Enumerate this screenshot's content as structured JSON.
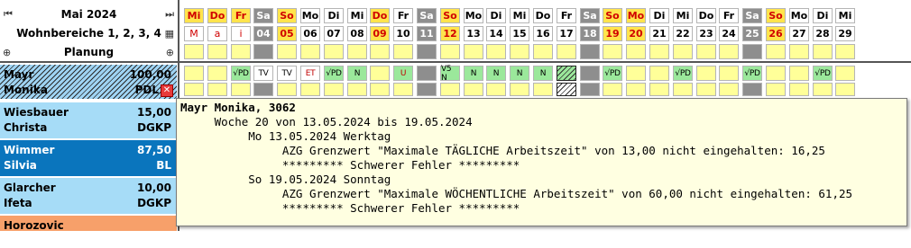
{
  "header": {
    "month": "Mai 2024",
    "unit": "Wohnbereiche 1, 2, 3, 4",
    "view": "Planung"
  },
  "days": [
    {
      "d": "Mi",
      "n": "M",
      "t": "hol"
    },
    {
      "d": "Do",
      "n": "a",
      "t": "hol"
    },
    {
      "d": "Fr",
      "n": "i",
      "t": "hol"
    },
    {
      "d": "Sa",
      "n": "04",
      "t": "we"
    },
    {
      "d": "So",
      "n": "05",
      "t": "so"
    },
    {
      "d": "Mo",
      "n": "06",
      "t": ""
    },
    {
      "d": "Di",
      "n": "07",
      "t": ""
    },
    {
      "d": "Mi",
      "n": "08",
      "t": ""
    },
    {
      "d": "Do",
      "n": "09",
      "t": "so"
    },
    {
      "d": "Fr",
      "n": "10",
      "t": ""
    },
    {
      "d": "Sa",
      "n": "11",
      "t": "we"
    },
    {
      "d": "So",
      "n": "12",
      "t": "so"
    },
    {
      "d": "Mo",
      "n": "13",
      "t": ""
    },
    {
      "d": "Di",
      "n": "14",
      "t": ""
    },
    {
      "d": "Mi",
      "n": "15",
      "t": ""
    },
    {
      "d": "Do",
      "n": "16",
      "t": ""
    },
    {
      "d": "Fr",
      "n": "17",
      "t": ""
    },
    {
      "d": "Sa",
      "n": "18",
      "t": "we"
    },
    {
      "d": "So",
      "n": "19",
      "t": "so"
    },
    {
      "d": "Mo",
      "n": "20",
      "t": "so"
    },
    {
      "d": "Di",
      "n": "21",
      "t": ""
    },
    {
      "d": "Mi",
      "n": "22",
      "t": ""
    },
    {
      "d": "Do",
      "n": "23",
      "t": ""
    },
    {
      "d": "Fr",
      "n": "24",
      "t": ""
    },
    {
      "d": "Sa",
      "n": "25",
      "t": "we"
    },
    {
      "d": "So",
      "n": "26",
      "t": "so"
    },
    {
      "d": "Mo",
      "n": "27",
      "t": ""
    },
    {
      "d": "Di",
      "n": "28",
      "t": ""
    },
    {
      "d": "Mi",
      "n": "29",
      "t": ""
    }
  ],
  "shifts": [
    "",
    "",
    "√PD",
    "TV",
    "TV",
    "ET",
    "√PD",
    "N",
    "",
    "U",
    "",
    "V5 N",
    "N",
    "N",
    "N",
    "N",
    "",
    "",
    "√PD",
    "",
    "",
    "√PD",
    "",
    "",
    "√PD",
    "",
    "",
    "√PD",
    ""
  ],
  "employees": [
    {
      "last": "Mayr",
      "first": "Monika",
      "hours": "100,00",
      "role": "PDL",
      "style": "selected"
    },
    {
      "last": "Wiesbauer",
      "first": "Christa",
      "hours": "15,00",
      "role": "DGKP",
      "style": "light"
    },
    {
      "last": "Wimmer",
      "first": "Silvia",
      "hours": "87,50",
      "role": "BL",
      "style": "dark"
    },
    {
      "last": "Glarcher",
      "first": "Ifeta",
      "hours": "10,00",
      "role": "DGKP",
      "style": "light"
    },
    {
      "last": "Horozovic",
      "first": "",
      "hours": "",
      "role": "",
      "style": "orange"
    }
  ],
  "tooltip": {
    "lines": [
      "Mayr Monika, 3062",
      "     Woche 20 von 13.05.2024 bis 19.05.2024",
      "          Mo 13.05.2024 Werktag",
      "               AZG Grenzwert \"Maximale TÄGLICHE Arbeitszeit\" von 13,00 nicht eingehalten: 16,25",
      "               ********* Schwerer Fehler *********",
      "          So 19.05.2024 Sonntag",
      "               AZG Grenzwert \"Maximale WÖCHENTLICHE Arbeitszeit\" von 60,00 nicht eingehalten: 61,25",
      "               ********* Schwerer Fehler *********"
    ]
  },
  "colors": {
    "weekend": "#8e8e8e",
    "holiday": "#ffe44d",
    "plan_yellow": "#ffff99",
    "shift_green": "#9be89b",
    "emp_light": "#a6dcf7",
    "emp_dark": "#0a75bd",
    "emp_orange": "#f7a06a",
    "tooltip_bg": "#ffffe1"
  }
}
